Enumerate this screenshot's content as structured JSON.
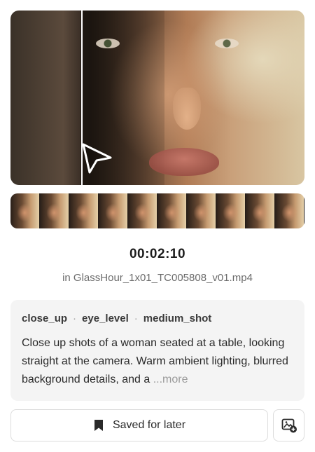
{
  "timecode": "00:02:10",
  "filename": "in GlassHour_1x01_TC005808_v01.mp4",
  "tags": [
    "close_up",
    "eye_level",
    "medium_shot"
  ],
  "tag_separator": "·",
  "description": "Close up shots of a woman seated at a table, looking straight at the camera. Warm ambient lighting, blurred background details, and a",
  "more_label": "...more",
  "save_button_label": "Saved for later",
  "filmstrip_frame_count": 10,
  "scrub_position": 0.24,
  "icons": {
    "cursor": "pointer-arrow-icon",
    "bookmark": "bookmark-icon",
    "image_add": "image-add-icon"
  }
}
